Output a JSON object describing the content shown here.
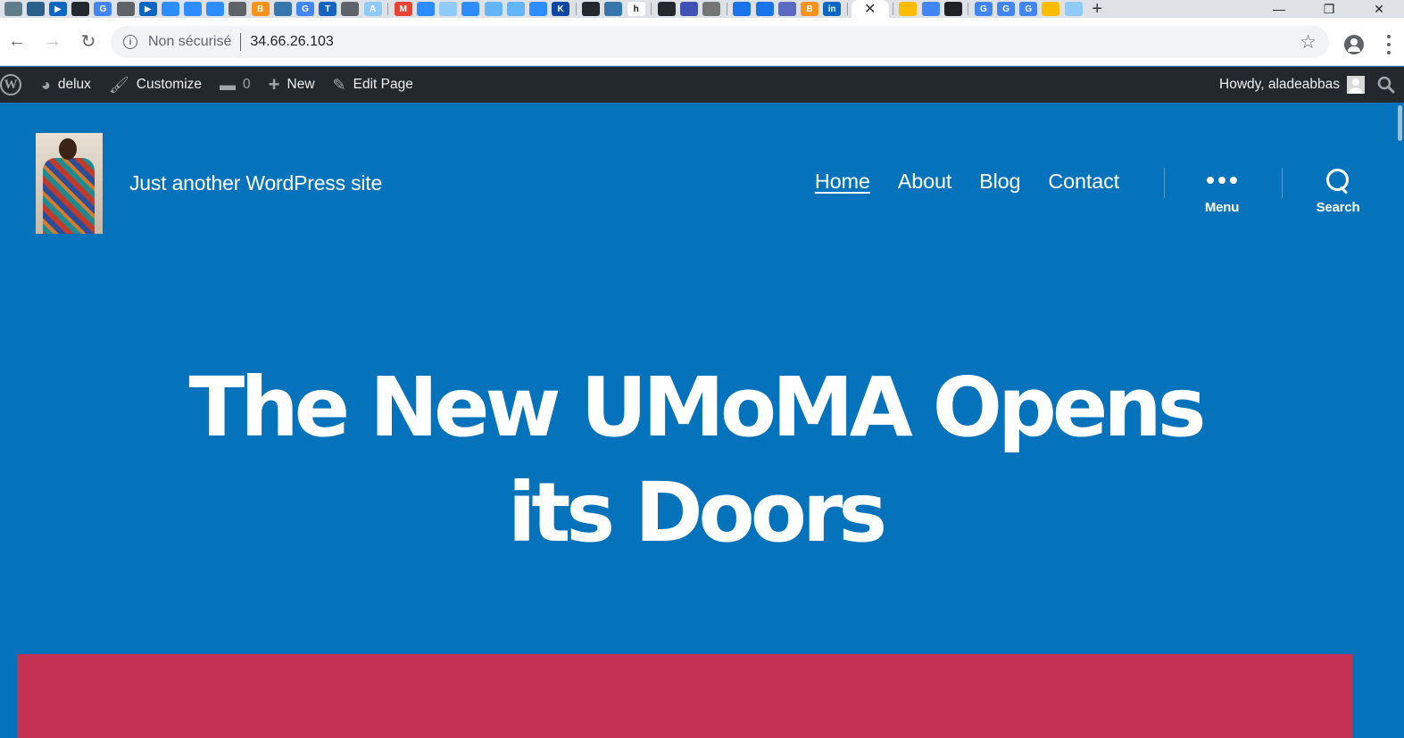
{
  "browser": {
    "tab_icons": [
      {
        "name": "favicon-1",
        "color": "#607d8b",
        "glyph": ""
      },
      {
        "name": "favicon-2",
        "color": "#2c5f8a",
        "glyph": ""
      },
      {
        "name": "favicon-3",
        "color": "#0a66c2",
        "glyph": "▶"
      },
      {
        "name": "github-icon",
        "color": "#24292e",
        "glyph": ""
      },
      {
        "name": "google-icon",
        "color": "#4285f4",
        "glyph": "G"
      },
      {
        "name": "globe-icon",
        "color": "#5f6368",
        "glyph": ""
      },
      {
        "name": "favicon-7",
        "color": "#0a66c2",
        "glyph": "▶"
      },
      {
        "name": "zoom-icon",
        "color": "#2d8cff",
        "glyph": ""
      },
      {
        "name": "zoom-icon",
        "color": "#2d8cff",
        "glyph": ""
      },
      {
        "name": "zoom-icon",
        "color": "#2d8cff",
        "glyph": ""
      },
      {
        "name": "globe-icon",
        "color": "#5f6368",
        "glyph": ""
      },
      {
        "name": "bitcoin-icon",
        "color": "#f7931a",
        "glyph": "B"
      },
      {
        "name": "python-icon",
        "color": "#3776ab",
        "glyph": ""
      },
      {
        "name": "google-icon",
        "color": "#4285f4",
        "glyph": "G"
      },
      {
        "name": "favicon-15",
        "color": "#1565c0",
        "glyph": "T"
      },
      {
        "name": "globe-icon",
        "color": "#5f6368",
        "glyph": ""
      },
      {
        "name": "api-icon",
        "color": "#90caf9",
        "glyph": "A"
      }
    ],
    "tab_icons_b": [
      {
        "name": "gmail-icon",
        "color": "#ea4335",
        "glyph": "M"
      },
      {
        "name": "zoom-icon",
        "color": "#2d8cff",
        "glyph": ""
      },
      {
        "name": "favicon-20",
        "color": "#90caf9",
        "glyph": ""
      },
      {
        "name": "zoom-icon",
        "color": "#2d8cff",
        "glyph": ""
      },
      {
        "name": "favicon-22",
        "color": "#64b5f6",
        "glyph": ""
      },
      {
        "name": "favicon-23",
        "color": "#64b5f6",
        "glyph": ""
      },
      {
        "name": "zoom-icon",
        "color": "#2d8cff",
        "glyph": ""
      },
      {
        "name": "favicon-k",
        "color": "#0d47a1",
        "glyph": "K"
      }
    ],
    "tab_icons_c": [
      {
        "name": "github-icon",
        "color": "#24292e",
        "glyph": ""
      },
      {
        "name": "python-icon",
        "color": "#3776ab",
        "glyph": ""
      },
      {
        "name": "favicon-h",
        "color": "#ffffff",
        "glyph": "h"
      }
    ],
    "tab_icons_d": [
      {
        "name": "github-icon",
        "color": "#24292e",
        "glyph": ""
      },
      {
        "name": "favicon-bars",
        "color": "#3f51b5",
        "glyph": ""
      },
      {
        "name": "gear-icon",
        "color": "#757575",
        "glyph": ""
      }
    ],
    "tab_icons_e": [
      {
        "name": "gear-icon",
        "color": "#1a73e8",
        "glyph": ""
      },
      {
        "name": "gear-icon",
        "color": "#1a73e8",
        "glyph": ""
      },
      {
        "name": "favicon-x",
        "color": "#5c6bc0",
        "glyph": ""
      },
      {
        "name": "bitcoin-icon",
        "color": "#f7931a",
        "glyph": "B"
      },
      {
        "name": "linkedin-icon",
        "color": "#0a66c2",
        "glyph": "in"
      }
    ],
    "tab_icons_f": [
      {
        "name": "drive-icon",
        "color": "#fbbc04",
        "glyph": ""
      },
      {
        "name": "chip-icon",
        "color": "#4285f4",
        "glyph": ""
      },
      {
        "name": "cursor-icon",
        "color": "#202124",
        "glyph": ""
      }
    ],
    "tab_icons_g": [
      {
        "name": "google-icon",
        "color": "#4285f4",
        "glyph": "G"
      },
      {
        "name": "google-icon",
        "color": "#4285f4",
        "glyph": "G"
      },
      {
        "name": "google-icon",
        "color": "#4285f4",
        "glyph": "G"
      },
      {
        "name": "drive-icon",
        "color": "#fbbc04",
        "glyph": ""
      },
      {
        "name": "favicon-last",
        "color": "#90caf9",
        "glyph": ""
      }
    ],
    "active_tab_close": "✕",
    "new_tab": "+",
    "window": {
      "minimize": "—",
      "restore": "❐",
      "close": "✕"
    },
    "toolbar": {
      "back": "←",
      "forward": "→",
      "reload": "↻",
      "security_label": "Non sécurisé",
      "url": "34.66.26.103",
      "bookmark": "☆"
    }
  },
  "adminbar": {
    "site_name": "delux",
    "customize": "Customize",
    "comments_count": "0",
    "new": "New",
    "edit_page": "Edit Page",
    "howdy": "Howdy, aladeabbas"
  },
  "site": {
    "description": "Just another WordPress site",
    "nav": [
      "Home",
      "About",
      "Blog",
      "Contact"
    ],
    "menu_label": "Menu",
    "search_label": "Search",
    "hero_title_line1": "The New UMoMA Opens",
    "hero_title_line2": "its Doors"
  },
  "colors": {
    "header_bg": "#0573bb",
    "admin_bar": "#23282d",
    "featured_block": "#c33252"
  }
}
